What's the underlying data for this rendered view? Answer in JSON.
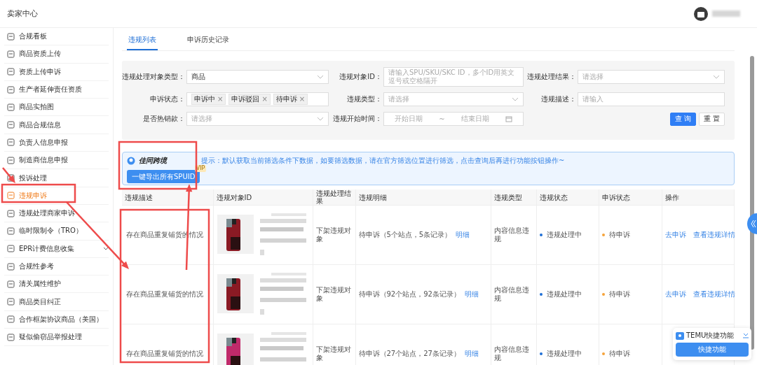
{
  "header": {
    "title": "卖家中心"
  },
  "sidebar": {
    "items": [
      {
        "label": "合规看板",
        "selected": false
      },
      {
        "label": "商品资质上传",
        "selected": false
      },
      {
        "label": "资质上传申诉",
        "selected": false
      },
      {
        "label": "生产者延伸责任资质",
        "selected": false
      },
      {
        "label": "商品实拍图",
        "selected": false
      },
      {
        "label": "商品合规信息",
        "selected": false
      },
      {
        "label": "负责人信息申报",
        "selected": false
      },
      {
        "label": "制造商信息申报",
        "selected": false
      },
      {
        "label": "投诉处理",
        "selected": false
      },
      {
        "label": "违规申诉",
        "selected": true
      },
      {
        "label": "违规处理商家申诉",
        "selected": false
      },
      {
        "label": "临时限制令（TRO）",
        "selected": false
      },
      {
        "label": "EPR计费信息收集",
        "selected": false,
        "has_submenu": true
      },
      {
        "label": "合规性参考",
        "selected": false
      },
      {
        "label": "清关属性维护",
        "selected": false
      },
      {
        "label": "商品类目纠正",
        "selected": false
      },
      {
        "label": "合作框架协议商品（美国）",
        "selected": false
      },
      {
        "label": "疑似偷窃品举报处理",
        "selected": false
      }
    ]
  },
  "tabs": [
    {
      "label": "违规列表",
      "selected": true
    },
    {
      "label": "申诉历史记录",
      "selected": false
    }
  ],
  "filters": [
    {
      "label": "违规处理对象类型：",
      "kind": "select",
      "value": "商品"
    },
    {
      "label": "违规对象ID：",
      "kind": "input",
      "placeholder": "请输入SPU/SKU/SKC ID，多个ID用英文逗号或空格隔开"
    },
    {
      "label": "违规处理结果：",
      "kind": "select",
      "placeholder": "请选择"
    },
    {
      "label": "申诉状态：",
      "kind": "tags",
      "tags": [
        {
          "label": "申诉中",
          "remove": "×"
        },
        {
          "label": "申诉驳回",
          "remove": "×"
        },
        {
          "label": "待申诉",
          "remove": "×"
        }
      ]
    },
    {
      "label": "违规类型：",
      "kind": "select",
      "placeholder": "请选择"
    },
    {
      "label": "违规描述：",
      "kind": "input",
      "placeholder": "请输入"
    },
    {
      "label": "是否热销款：",
      "kind": "select",
      "placeholder": "请选择"
    },
    {
      "label": "违规开始时间：",
      "kind": "daterange",
      "start_placeholder": "开始日期",
      "separator": "~",
      "end_placeholder": "结束日期"
    }
  ],
  "filter_buttons": [
    {
      "label": "查 询",
      "kind": "primary"
    },
    {
      "label": "重 置",
      "kind": "default"
    }
  ],
  "plugin_banner": {
    "brand": "佳同跨境",
    "hint": "提示：默认获取当前筛选条件下数据，如要筛选数据，请在官方筛选位置进行筛选，点击查询后再进行功能按钮操作~",
    "button": "一键导出所有SPUID",
    "badge": "VIP"
  },
  "table": {
    "columns": [
      "违规描述",
      "违规对象ID",
      "违规处理结果",
      "违规明细",
      "违规类型",
      "违规状态",
      "申诉状态",
      "操作"
    ],
    "rows": [
      {
        "description": "存在商品重复铺货的情况",
        "image": {
          "kind": "picture"
        },
        "result": "下架违规对象",
        "detail": "待申诉（5个站点，5条记录）",
        "detail_link": "明细",
        "type": "内容信息违规",
        "status": {
          "text": "违规处理中",
          "color": "#1f6fd6"
        },
        "appeal": {
          "text": "待申诉",
          "color": "#f5a33b"
        },
        "actions": [
          "去申诉",
          "查看违规详情"
        ]
      },
      {
        "description": "存在商品重复铺货的情况",
        "image": {
          "kind": "picture"
        },
        "result": "下架违规对象",
        "detail": "待申诉（92个站点，92条记录）",
        "detail_link": "明细",
        "type": "内容信息违规",
        "status": {
          "text": "违规处理中",
          "color": "#1f6fd6"
        },
        "appeal": {
          "text": "待申诉",
          "color": "#f5a33b"
        },
        "actions": [
          "去申诉",
          "查看违规详情"
        ]
      },
      {
        "description": "存在商品重复铺货的情况",
        "image": {
          "kind": "picture"
        },
        "result": "下架违规对象",
        "detail": "待申诉（27个站点，27条记录）",
        "detail_link": "明细",
        "type": "内容信息违规",
        "status": {
          "text": "违规处理中",
          "color": "#1f6fd6"
        },
        "appeal": {
          "text": "待申诉",
          "color": "#f5a33b"
        },
        "actions": []
      }
    ]
  },
  "quick_widget": {
    "title": "TEMU快捷功能",
    "button": "快捷功能"
  }
}
